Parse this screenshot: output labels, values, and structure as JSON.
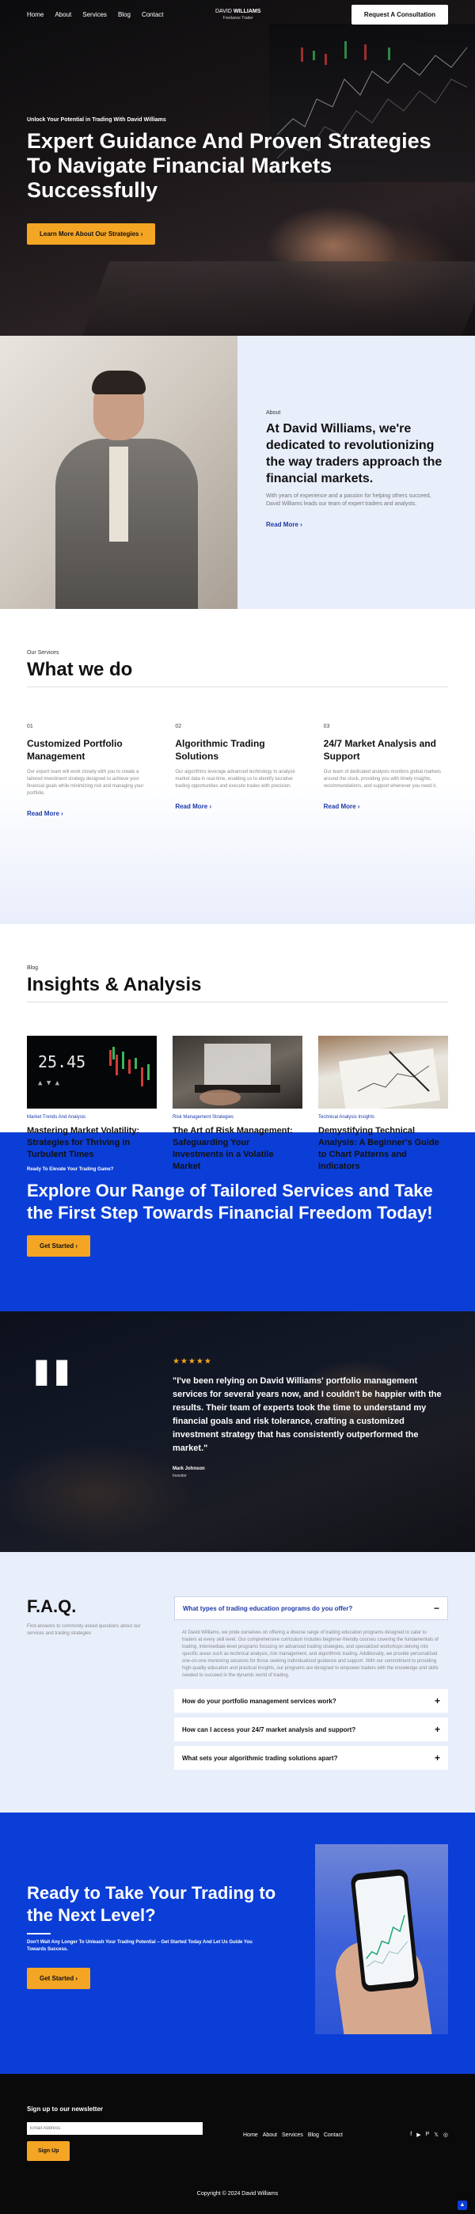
{
  "nav": {
    "links": [
      "Home",
      "About",
      "Services",
      "Blog",
      "Contact"
    ],
    "logo_name_first": "DAVID",
    "logo_name_last": "WILLIAMS",
    "logo_tagline": "Freelance Trader",
    "cta": "Request A Consultation"
  },
  "hero": {
    "kicker": "Unlock Your Potential in Trading With David Williams",
    "title": "Expert Guidance And Proven Strategies To Navigate Financial Markets Successfully",
    "button": "Learn More About Our Strategies"
  },
  "about": {
    "kicker": "About",
    "title": "At David Williams, we're dedicated to revolutionizing the way traders approach the financial markets.",
    "body": "With years of experience and a passion for helping others succeed, David Williams leads our team of expert traders and analysts.",
    "read_more": "Read More"
  },
  "services": {
    "kicker": "Our Services",
    "title": "What we do",
    "items": [
      {
        "num": "01",
        "title": "Customized Portfolio Management",
        "body": "Our expert team will work closely with you to create a tailored investment strategy designed to achieve your financial goals while minimizing risk and managing your portfolio.",
        "read_more": "Read More"
      },
      {
        "num": "02",
        "title": "Algorithmic Trading Solutions",
        "body": "Our algorithms leverage advanced technology to analyze market data in real-time, enabling us to identify lucrative trading opportunities and execute trades with precision.",
        "read_more": "Read More"
      },
      {
        "num": "03",
        "title": "24/7 Market Analysis and Support",
        "body": "Our team of dedicated analysts monitors global markets around the clock, providing you with timely insights, recommendations, and support whenever you need it.",
        "read_more": "Read More"
      }
    ]
  },
  "blog": {
    "kicker": "Blog",
    "title": "Insights & Analysis",
    "posts": [
      {
        "category": "Market Trends And Analysis",
        "title": "Mastering Market Volatility: Strategies for Thriving in Turbulent Times",
        "image_text": "25.45"
      },
      {
        "category": "Risk Management Strategies",
        "title": "The Art of Risk Management: Safeguarding Your Investments in a Volatile Market"
      },
      {
        "category": "Technical Analysis Insights",
        "title": "Demystifying Technical Analysis: A Beginner's Guide to Chart Patterns and Indicators"
      }
    ]
  },
  "cta_blue": {
    "kicker": "Ready To Elevate Your Trading Game?",
    "title": "Explore Our Range of Tailored Services and Take the First Step Towards Financial Freedom Today!",
    "button": "Get Started"
  },
  "testimonial": {
    "stars": "★★★★★",
    "quote": "\"I've been relying on David Williams' portfolio management services for several years now, and I couldn't be happier with the results. Their team of experts took the time to understand my financial goals and risk tolerance, crafting a customized investment strategy that has consistently outperformed the market.\"",
    "author": "Mark Johnson",
    "role": "Investor"
  },
  "faq": {
    "title": "F.A.Q.",
    "subtitle": "Find answers to commonly asked questions about our services and trading strategies",
    "open_question": "What types of trading education programs do you offer?",
    "open_answer": "At David Williams, we pride ourselves on offering a diverse range of trading education programs designed to cater to traders at every skill level. Our comprehensive curriculum includes beginner-friendly courses covering the fundamentals of trading, intermediate-level programs focusing on advanced trading strategies, and specialized workshops delving into specific areas such as technical analysis, risk management, and algorithmic trading. Additionally, we provide personalized one-on-one mentoring sessions for those seeking individualized guidance and support. With our commitment to providing high-quality education and practical insights, our programs are designed to empower traders with the knowledge and skills needed to succeed in the dynamic world of trading.",
    "questions": [
      "How do your portfolio management services work?",
      "How can I access your 24/7 market analysis and support?",
      "What sets your algorithmic trading solutions apart?"
    ]
  },
  "ready": {
    "title": "Ready to Take Your Trading to the Next Level?",
    "body": "Don't Wait Any Longer To Unleash Your Trading Potential – Get Started Today And Let Us Guide You Towards Success.",
    "button": "Get Started"
  },
  "footer": {
    "newsletter_title": "Sign up to our newsletter",
    "email_placeholder": "Email Address",
    "signup": "Sign Up",
    "links": [
      "Home",
      "About",
      "Services",
      "Blog",
      "Contact"
    ],
    "social_icons": [
      "facebook-icon",
      "youtube-icon",
      "pinterest-icon",
      "twitter-icon",
      "instagram-icon"
    ],
    "copyright": "Copyright © 2024 David Williams"
  },
  "colors": {
    "brand_blue": "#0b3ed6",
    "accent_yellow": "#f5a524",
    "link_blue": "#1d3aa8"
  }
}
